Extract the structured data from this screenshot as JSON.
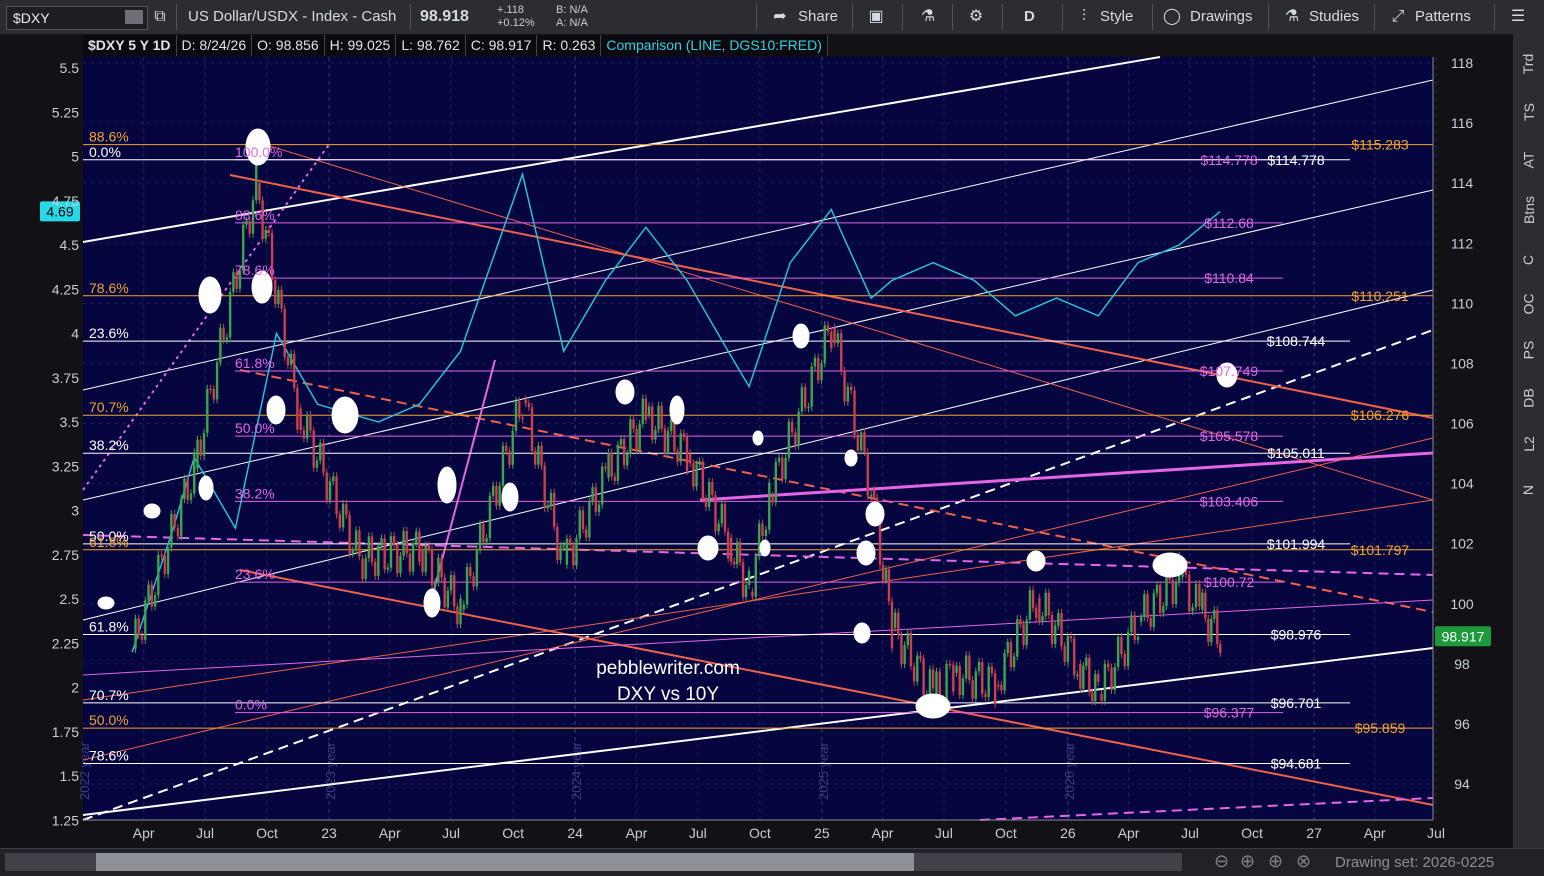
{
  "toolbar": {
    "symbol": "$DXY",
    "description": "US Dollar/USDX - Index - Cash",
    "price": "98.918",
    "change": "+.118",
    "change_pct": "+0.12%",
    "bid": "B: N/A",
    "ask": "A: N/A",
    "share_label": "Share",
    "period_label": "D",
    "style_label": "Style",
    "drawings_label": "Drawings",
    "studies_label": "Studies",
    "patterns_label": "Patterns"
  },
  "infobar": {
    "title": "$DXY 5 Y 1D",
    "date": "D: 8/24/26",
    "open": "O: 98.856",
    "high": "H: 99.025",
    "low": "L: 98.762",
    "close": "C: 98.917",
    "range": "R: 0.263",
    "comparison": "Comparison (LINE, DGS10:FRED)"
  },
  "sidebar": [
    "Trd",
    "TS",
    "AT",
    "Btns",
    "C",
    "OC",
    "PS",
    "DB",
    "L2",
    "N"
  ],
  "bottombar": {
    "drawing_set": "Drawing set: 2026-0225"
  },
  "colors": {
    "plot_bg": "#050540",
    "orange": "#f4a52a",
    "magenta": "#e565e5",
    "salmon": "#f0604a",
    "cyan": "#27c0d8",
    "white": "#ffffff",
    "up": "#3fa34d",
    "down": "#c8414b"
  },
  "chart_data": {
    "type": "line",
    "title": "pebblewriter.com DXY vs 10Y",
    "xlabel": "",
    "ylabel": "",
    "left_axis": {
      "ticks": [
        "5.5",
        "5.25",
        "5",
        "4.75",
        "4.5",
        "4.25",
        "4",
        "3.75",
        "3.5",
        "3.25",
        "3",
        "2.75",
        "2.5",
        "2.25",
        "2",
        "1.75",
        "1.5",
        "1.25"
      ],
      "ylim": [
        1.25,
        5.6
      ],
      "current": "4.69"
    },
    "right_axis": {
      "ticks": [
        "118",
        "116",
        "114",
        "112",
        "110",
        "108",
        "106",
        "104",
        "102",
        "100",
        "98",
        "96",
        "94"
      ],
      "ylim": [
        93,
        119
      ],
      "current": "98.917"
    },
    "x_tick_labels": [
      "Apr",
      "Jul",
      "Oct",
      "23",
      "Apr",
      "Jul",
      "Oct",
      "24",
      "Apr",
      "Jul",
      "Oct",
      "25",
      "Apr",
      "Jul",
      "Oct",
      "26",
      "Apr",
      "Jul",
      "Oct",
      "27",
      "Apr",
      "Jul"
    ],
    "year_labels": [
      "2022 year",
      "2023 year",
      "2024 year",
      "2025 year",
      "2026 year"
    ],
    "series": [
      {
        "name": "$DXY",
        "style": "candles",
        "x": [
          "2022-03",
          "2022-06",
          "2022-09",
          "2022-11",
          "2023-02",
          "2023-05",
          "2023-07",
          "2023-10",
          "2023-12",
          "2024-02",
          "2024-04",
          "2024-06",
          "2024-08",
          "2024-09",
          "2024-10",
          "2025-01",
          "2025-03",
          "2025-04",
          "2025-06",
          "2025-07",
          "2025-09",
          "2025-11",
          "2026-01",
          "2026-02",
          "2026-04",
          "2026-06",
          "2026-07",
          "2026-08"
        ],
        "values": [
          98.5,
          104.5,
          114.0,
          106.5,
          101.5,
          101.8,
          99.8,
          106.8,
          101.3,
          104.2,
          106.3,
          105.0,
          102.2,
          100.4,
          103.6,
          109.2,
          103.8,
          99.2,
          97.0,
          97.7,
          97.3,
          100.2,
          98.0,
          97.0,
          99.4,
          100.9,
          99.8,
          98.9
        ]
      },
      {
        "name": "Comparison (LINE, DGS10:FRED)",
        "style": "line",
        "x": [
          "2022-03",
          "2022-05",
          "2022-06",
          "2022-08",
          "2022-10",
          "2022-12",
          "2023-03",
          "2023-05",
          "2023-07",
          "2023-10",
          "2023-12",
          "2024-02",
          "2024-04",
          "2024-06",
          "2024-08",
          "2024-09",
          "2024-11",
          "2025-01",
          "2025-03",
          "2025-04",
          "2025-06",
          "2025-08",
          "2025-10",
          "2025-12",
          "2026-02",
          "2026-04",
          "2026-06",
          "2026-08"
        ],
        "values": [
          2.2,
          2.9,
          3.3,
          2.9,
          4.0,
          3.6,
          3.5,
          3.6,
          3.9,
          4.9,
          3.9,
          4.3,
          4.6,
          4.3,
          3.9,
          3.7,
          4.4,
          4.7,
          4.2,
          4.3,
          4.4,
          4.3,
          4.1,
          4.2,
          4.1,
          4.4,
          4.5,
          4.69
        ]
      }
    ],
    "annotations_right": [
      {
        "text": "$115.283",
        "value": 115.283,
        "color": "orange"
      },
      {
        "text": "$114.778",
        "value": 114.778,
        "color": "magenta"
      },
      {
        "text": "$114.778",
        "value": 114.778,
        "color": "white"
      },
      {
        "text": "$112.68",
        "value": 112.68,
        "color": "magenta"
      },
      {
        "text": "$110.84",
        "value": 110.84,
        "color": "magenta"
      },
      {
        "text": "$110.251",
        "value": 110.251,
        "color": "orange"
      },
      {
        "text": "$108.744",
        "value": 108.744,
        "color": "white"
      },
      {
        "text": "$107.749",
        "value": 107.749,
        "color": "magenta"
      },
      {
        "text": "$106.276",
        "value": 106.276,
        "color": "orange"
      },
      {
        "text": "$105.578",
        "value": 105.578,
        "color": "magenta"
      },
      {
        "text": "$105.011",
        "value": 105.011,
        "color": "white"
      },
      {
        "text": "$103.406",
        "value": 103.406,
        "color": "magenta"
      },
      {
        "text": "$101.994",
        "value": 101.994,
        "color": "white"
      },
      {
        "text": "$101.797",
        "value": 101.797,
        "color": "orange"
      },
      {
        "text": "$100.72",
        "value": 100.72,
        "color": "magenta"
      },
      {
        "text": "$98.976",
        "value": 98.976,
        "color": "white"
      },
      {
        "text": "$96.701",
        "value": 96.701,
        "color": "white"
      },
      {
        "text": "$96.377",
        "value": 96.377,
        "color": "magenta"
      },
      {
        "text": "$95.859",
        "value": 95.859,
        "color": "orange"
      },
      {
        "text": "$94.681",
        "value": 94.681,
        "color": "white"
      }
    ],
    "fib_labels": [
      {
        "text": "88.6%",
        "value": 115.283,
        "color": "orange"
      },
      {
        "text": "0.0%",
        "value": 114.778,
        "color": "white"
      },
      {
        "text": "100.0%",
        "value": 114.778,
        "color": "magenta"
      },
      {
        "text": "88.6%",
        "value": 112.68,
        "color": "magenta"
      },
      {
        "text": "78.6%",
        "value": 110.84,
        "color": "magenta"
      },
      {
        "text": "78.6%",
        "value": 110.251,
        "color": "orange"
      },
      {
        "text": "23.6%",
        "value": 108.744,
        "color": "white"
      },
      {
        "text": "61.8%",
        "value": 107.749,
        "color": "magenta"
      },
      {
        "text": "70.7%",
        "value": 106.276,
        "color": "orange"
      },
      {
        "text": "50.0%",
        "value": 105.578,
        "color": "magenta"
      },
      {
        "text": "38.2%",
        "value": 105.011,
        "color": "white"
      },
      {
        "text": "38.2%",
        "value": 103.406,
        "color": "magenta"
      },
      {
        "text": "50.0%",
        "value": 101.994,
        "color": "white"
      },
      {
        "text": "61.8%",
        "value": 101.797,
        "color": "orange"
      },
      {
        "text": "23.6%",
        "value": 100.72,
        "color": "magenta"
      },
      {
        "text": "61.8%",
        "value": 98.976,
        "color": "white"
      },
      {
        "text": "70.7%",
        "value": 96.701,
        "color": "white"
      },
      {
        "text": "0.0%",
        "value": 96.377,
        "color": "magenta"
      },
      {
        "text": "50.0%",
        "value": 95.859,
        "color": "orange"
      },
      {
        "text": "78.6%",
        "value": 94.681,
        "color": "white"
      }
    ],
    "watermark": [
      "pebblewriter.com",
      "DXY vs 10Y"
    ],
    "grid": true
  }
}
